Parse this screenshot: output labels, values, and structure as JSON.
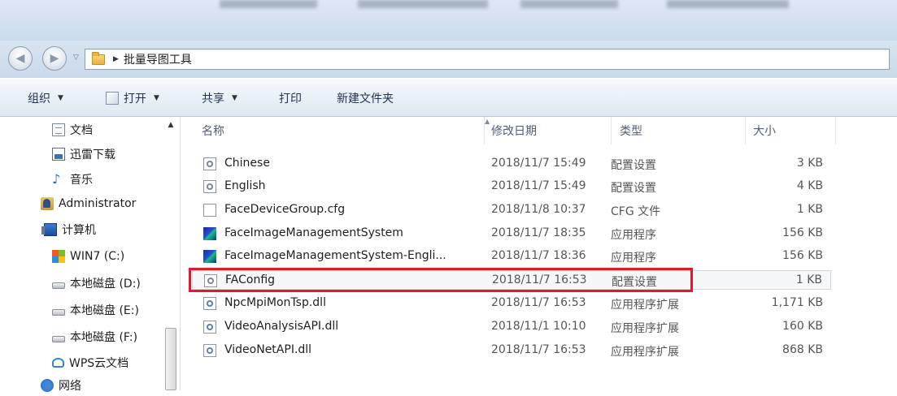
{
  "address": {
    "crumb": "批量导图工具"
  },
  "toolbar": {
    "organize": "组织",
    "open": "打开",
    "share": "共享",
    "print": "打印",
    "new_folder": "新建文件夹"
  },
  "nav": {
    "items": [
      {
        "label": "文档",
        "icon": "document-icon"
      },
      {
        "label": "迅雷下载",
        "icon": "download-icon"
      },
      {
        "label": "音乐",
        "icon": "music-icon"
      },
      {
        "label": "Administrator",
        "icon": "user-folder-icon"
      },
      {
        "label": "计算机",
        "icon": "computer-icon"
      },
      {
        "label": "WIN7 (C:)",
        "icon": "windows-drive-icon"
      },
      {
        "label": "本地磁盘 (D:)",
        "icon": "disk-icon"
      },
      {
        "label": "本地磁盘 (E:)",
        "icon": "disk-icon"
      },
      {
        "label": "本地磁盘 (F:)",
        "icon": "disk-icon"
      },
      {
        "label": "WPS云文档",
        "icon": "cloud-icon"
      },
      {
        "label": "网络",
        "icon": "network-icon"
      }
    ]
  },
  "columns": {
    "name": "名称",
    "date": "修改日期",
    "type": "类型",
    "size": "大小"
  },
  "files": [
    {
      "name": "Chinese",
      "date": "2018/11/7 15:49",
      "type": "配置设置",
      "size": "3 KB",
      "icon": "config-file-icon"
    },
    {
      "name": "English",
      "date": "2018/11/7 15:49",
      "type": "配置设置",
      "size": "4 KB",
      "icon": "config-file-icon"
    },
    {
      "name": "FaceDeviceGroup.cfg",
      "date": "2018/11/8 10:37",
      "type": "CFG 文件",
      "size": "1 KB",
      "icon": "blank-file-icon"
    },
    {
      "name": "FaceImageManagementSystem",
      "date": "2018/11/7 18:35",
      "type": "应用程序",
      "size": "156 KB",
      "icon": "application-icon"
    },
    {
      "name": "FaceImageManagementSystem-Engli...",
      "date": "2018/11/7 18:36",
      "type": "应用程序",
      "size": "156 KB",
      "icon": "application-icon"
    },
    {
      "name": "FAConfig",
      "date": "2018/11/7 16:53",
      "type": "配置设置",
      "size": "1 KB",
      "icon": "config-file-icon"
    },
    {
      "name": "NpcMpiMonTsp.dll",
      "date": "2018/11/7 16:53",
      "type": "应用程序扩展",
      "size": "1,171 KB",
      "icon": "dll-file-icon"
    },
    {
      "name": "VideoAnalysisAPI.dll",
      "date": "2018/11/1 10:10",
      "type": "应用程序扩展",
      "size": "160 KB",
      "icon": "dll-file-icon"
    },
    {
      "name": "VideoNetAPI.dll",
      "date": "2018/11/7 16:53",
      "type": "应用程序扩展",
      "size": "868 KB",
      "icon": "dll-file-icon"
    }
  ],
  "highlight_color": "#e0192e"
}
